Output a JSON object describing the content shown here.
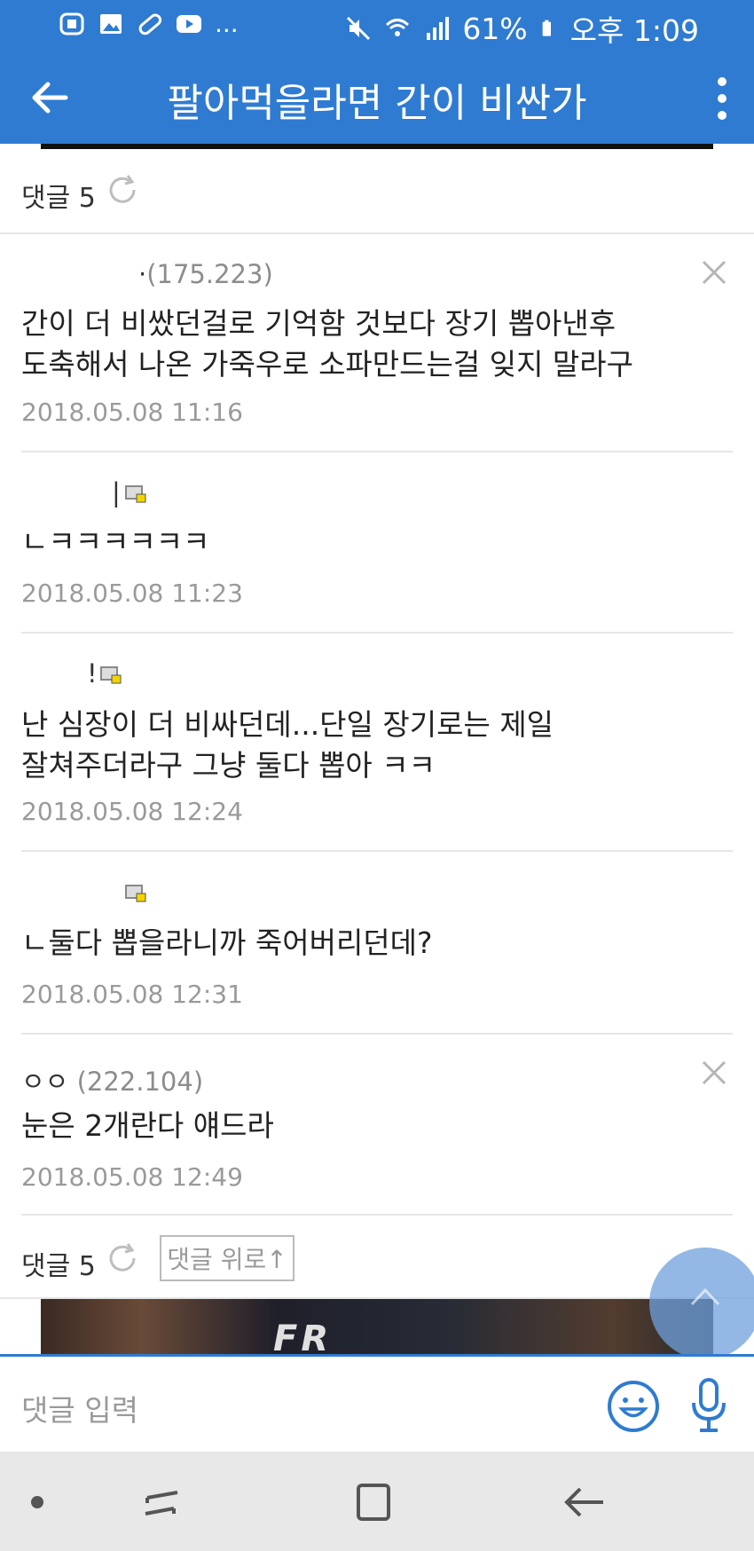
{
  "status_bar": {
    "icons_left": [
      "badge-icon",
      "gallery-icon",
      "pill-icon",
      "youtube-icon"
    ],
    "more": "...",
    "battery_pct": "61%",
    "time": "오후 1:09"
  },
  "app_bar": {
    "title": "팔아먹을라면 간이 비싼가"
  },
  "comments_header": {
    "label": "댓글 5"
  },
  "comments": [
    {
      "author": "·",
      "ip": "(175.223)",
      "text_lines": [
        "간이 더 비쌌던걸로 기억함 것보다 장기 뽑아낸후",
        "도축해서 나온 가죽우로 소파만드는걸 잊지 말라구"
      ],
      "date": "2018.05.08 11:16",
      "deletable": true
    },
    {
      "author": "|",
      "ip": "",
      "text_lines": [
        "ㄴㅋㅋㅋㅋㅋㅋ"
      ],
      "date": "2018.05.08 11:23",
      "deletable": false
    },
    {
      "author": "!",
      "ip": "",
      "text_lines": [
        "난 심장이 더 비싸던데...단일 장기로는 제일",
        "잘쳐주더라구 그냥 둘다 뽑아 ㅋㅋ"
      ],
      "date": "2018.05.08 12:24",
      "deletable": false
    },
    {
      "author": "",
      "ip": "",
      "text_lines": [
        "ㄴ둘다 뽑을라니까 죽어버리던데?"
      ],
      "date": "2018.05.08 12:31",
      "deletable": false
    },
    {
      "author": "ㅇㅇ",
      "ip": "(222.104)",
      "text_lines": [
        "눈은 2개란다 얘드라"
      ],
      "date": "2018.05.08 12:49",
      "deletable": true
    }
  ],
  "comments_footer": {
    "label": "댓글 5",
    "to_top": "댓글 위로↑"
  },
  "banner": {
    "text": "FR"
  },
  "input": {
    "placeholder": "댓글 입력"
  },
  "colors": {
    "primary": "#2f7bd2",
    "muted": "#9a9a9a"
  }
}
